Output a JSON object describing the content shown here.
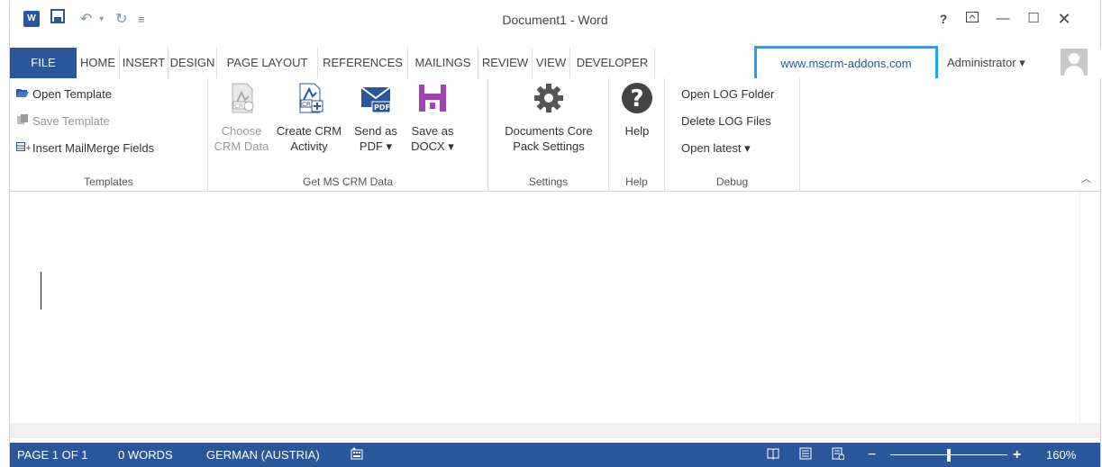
{
  "window": {
    "title": "Document1 - Word"
  },
  "titlebar": {
    "help": "?",
    "minimize": "—",
    "maximize": "☐",
    "close": "✕"
  },
  "tabs": {
    "file": "FILE",
    "home": "HOME",
    "insert": "INSERT",
    "design": "DESIGN",
    "page_layout": "PAGE LAYOUT",
    "references": "REFERENCES",
    "mailings": "MAILINGS",
    "review": "REVIEW",
    "view": "VIEW",
    "developer": "DEVELOPER",
    "addon": "www.mscrm-addons.com"
  },
  "account": {
    "name": "Administrator ▾"
  },
  "ribbon": {
    "templates": {
      "label": "Templates",
      "open_template": "Open Template",
      "save_template": "Save Template",
      "insert_mailmerge": "Insert MailMerge Fields"
    },
    "get_crm_data": {
      "label": "Get MS CRM Data",
      "choose_crm_data": [
        "Choose",
        "CRM Data"
      ],
      "create_crm_activity": [
        "Create CRM",
        "Activity"
      ],
      "send_as_pdf": [
        "Send as",
        "PDF ▾"
      ],
      "save_as_docx": [
        "Save as",
        "DOCX ▾"
      ]
    },
    "settings": {
      "label": "Settings",
      "documents_core": [
        "Documents Core",
        "Pack Settings"
      ]
    },
    "help": {
      "label": "Help",
      "help_button": "Help"
    },
    "debug": {
      "label": "Debug",
      "open_log_folder": "Open LOG Folder",
      "delete_log_files": "Delete LOG Files",
      "open_latest": "Open latest ▾"
    }
  },
  "status": {
    "page": "PAGE 1 OF 1",
    "words": "0 WORDS",
    "language": "GERMAN (AUSTRIA)",
    "zoom": "160%",
    "zoom_minus": "−",
    "zoom_plus": "+"
  },
  "colors": {
    "accent": "#2b579a",
    "addon_highlight": "#1ea7e8",
    "disabled_text": "#999999"
  }
}
